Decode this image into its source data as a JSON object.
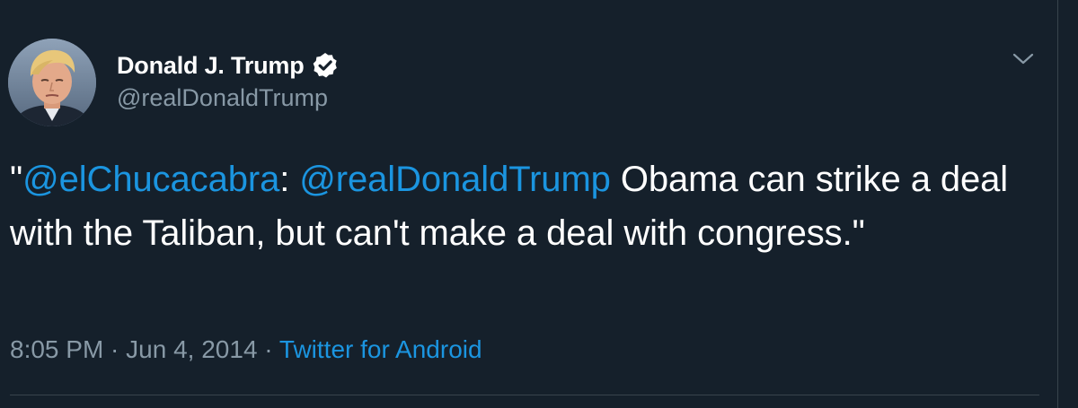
{
  "author": {
    "display_name": "Donald J. Trump",
    "handle": "@realDonaldTrump",
    "verified_icon": "verified-badge-icon",
    "avatar_icon": "profile-photo"
  },
  "menu": {
    "icon": "chevron-down-icon"
  },
  "tweet": {
    "quote_open": "\"",
    "mention_1": "@elChucacabra",
    "colon": ": ",
    "mention_2": "@realDonaldTrump",
    "body": " Obama can strike a deal with the Taliban, but can't make a deal with congress.",
    "quote_close": "\""
  },
  "meta": {
    "time": "8:05 PM",
    "separator_1": " · ",
    "date": "Jun 4, 2014",
    "separator_2": " · ",
    "source": "Twitter for Android"
  },
  "colors": {
    "background": "#15202b",
    "text": "#ffffff",
    "secondary": "#8899a6",
    "link": "#1b95e0",
    "border": "#38444d"
  }
}
